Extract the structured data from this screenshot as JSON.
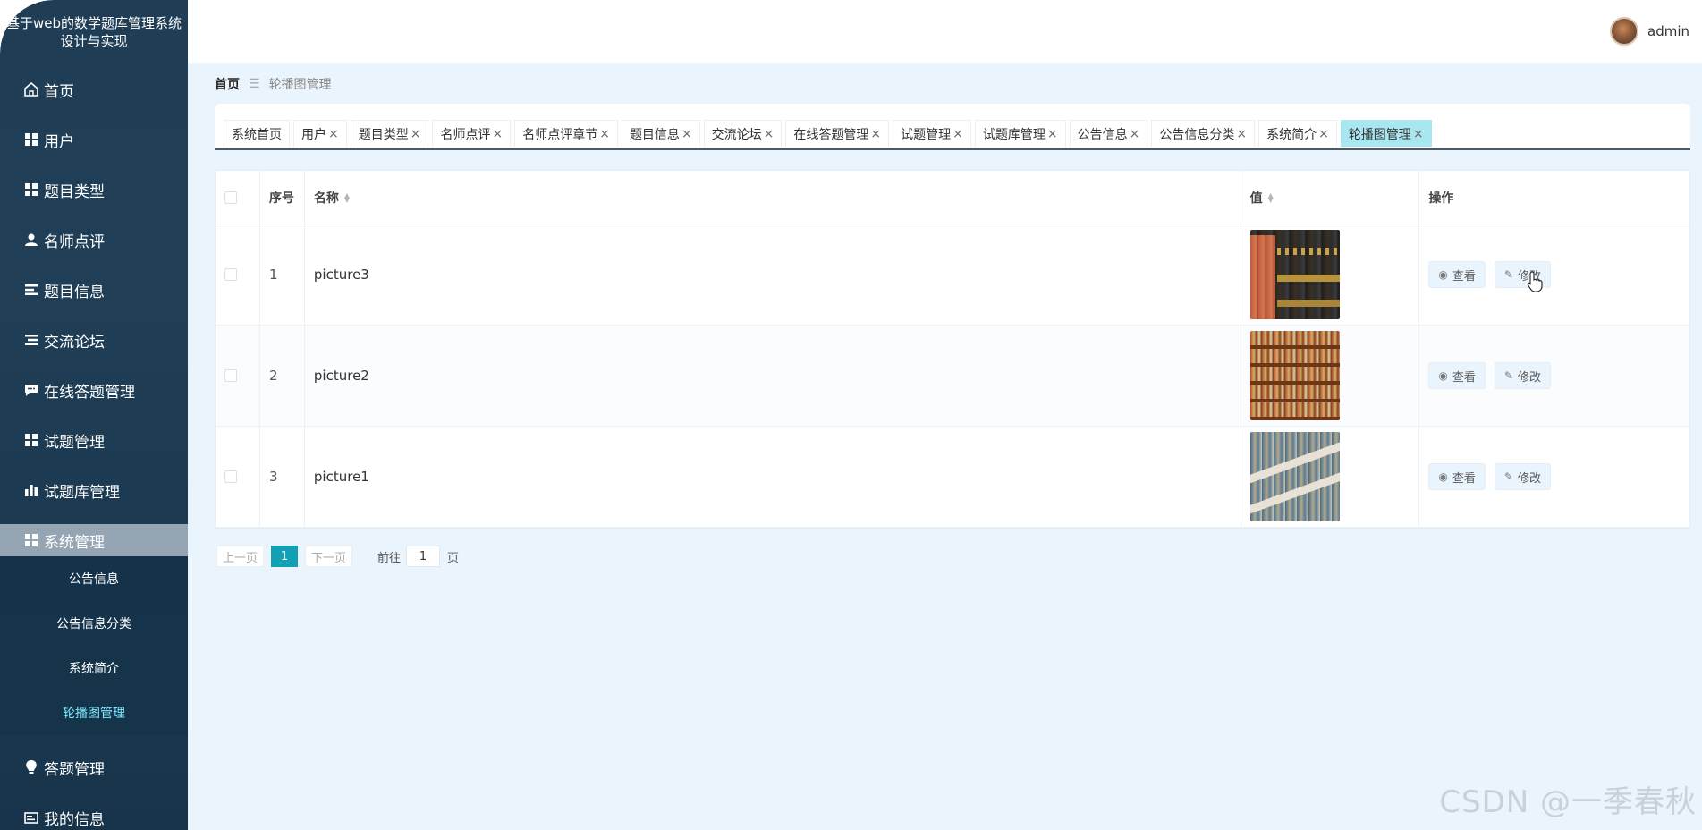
{
  "sidebar": {
    "brand": "基于web的数学题库管理系统设计与实现",
    "menu": [
      {
        "label": "首页",
        "icon": "home-icon"
      },
      {
        "label": "用户",
        "icon": "grid-icon"
      },
      {
        "label": "题目类型",
        "icon": "grid-icon"
      },
      {
        "label": "名师点评",
        "icon": "person-icon"
      },
      {
        "label": "题目信息",
        "icon": "list-icon"
      },
      {
        "label": "交流论坛",
        "icon": "list-icon"
      },
      {
        "label": "在线答题管理",
        "icon": "chat-icon"
      },
      {
        "label": "试题管理",
        "icon": "grid-icon"
      },
      {
        "label": "试题库管理",
        "icon": "bar-chart-icon"
      },
      {
        "label": "系统管理",
        "icon": "grid-icon"
      }
    ],
    "submenu": [
      {
        "label": "公告信息"
      },
      {
        "label": "公告信息分类"
      },
      {
        "label": "系统简介"
      },
      {
        "label": "轮播图管理"
      }
    ],
    "menu_after": [
      {
        "label": "答题管理",
        "icon": "bulb-icon"
      },
      {
        "label": "我的信息",
        "icon": "card-icon"
      }
    ]
  },
  "topbar": {
    "username": "admin"
  },
  "breadcrumb": {
    "home": "首页",
    "current": "轮播图管理"
  },
  "tabs": [
    {
      "label": "系统首页",
      "closable": false
    },
    {
      "label": "用户",
      "closable": true
    },
    {
      "label": "题目类型",
      "closable": true
    },
    {
      "label": "名师点评",
      "closable": true
    },
    {
      "label": "名师点评章节",
      "closable": true
    },
    {
      "label": "题目信息",
      "closable": true
    },
    {
      "label": "交流论坛",
      "closable": true
    },
    {
      "label": "在线答题管理",
      "closable": true
    },
    {
      "label": "试题管理",
      "closable": true
    },
    {
      "label": "试题库管理",
      "closable": true
    },
    {
      "label": "公告信息",
      "closable": true
    },
    {
      "label": "公告信息分类",
      "closable": true
    },
    {
      "label": "系统简介",
      "closable": true
    },
    {
      "label": "轮播图管理",
      "closable": true
    }
  ],
  "table": {
    "headers": {
      "index": "序号",
      "name": "名称",
      "value": "值",
      "ops": "操作"
    },
    "rows": [
      {
        "index": "1",
        "name": "picture3",
        "thumb": "books1"
      },
      {
        "index": "2",
        "name": "picture2",
        "thumb": "books2"
      },
      {
        "index": "3",
        "name": "picture1",
        "thumb": "books3"
      }
    ],
    "view_label": "查看",
    "edit_label": "修改"
  },
  "pagination": {
    "prev": "上一页",
    "current_page": "1",
    "next": "下一页",
    "goto_label": "前往",
    "goto_value": "1",
    "goto_suffix": "页"
  },
  "watermark": "CSDN @一季春秋",
  "colors": {
    "sidebar_bg": "#1f3e56",
    "accent": "#12a0b4",
    "active_tab": "#a8e7ef",
    "active_submenu": "#7fe8ff"
  }
}
